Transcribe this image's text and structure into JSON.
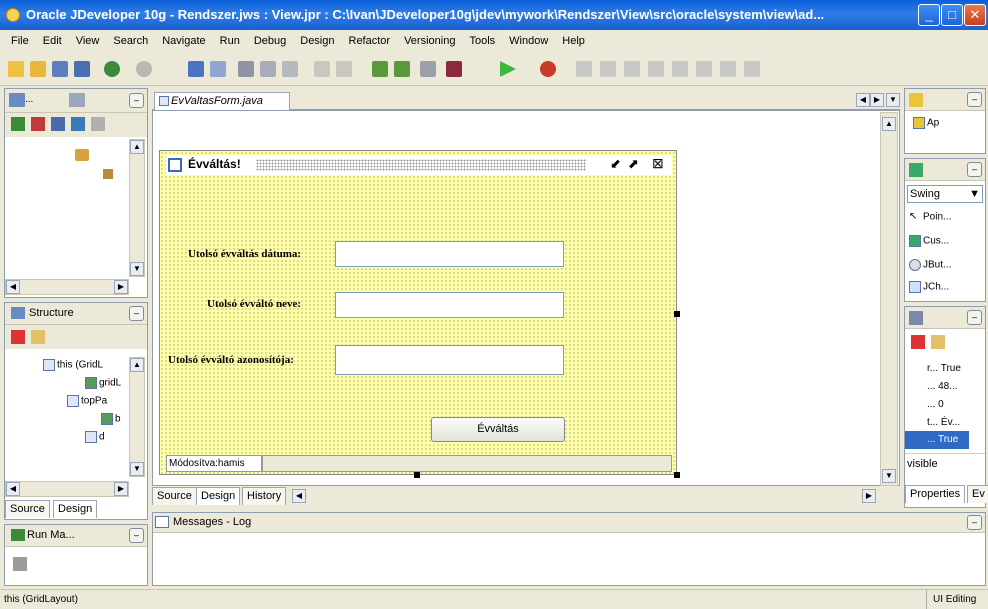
{
  "window": {
    "title": "Oracle JDeveloper 10g - Rendszer.jws : View.jpr : C:\\Ivan\\JDeveloper10g\\jdev\\mywork\\Rendszer\\View\\src\\oracle\\system\\view\\ad..."
  },
  "menu": [
    "File",
    "Edit",
    "View",
    "Search",
    "Navigate",
    "Run",
    "Debug",
    "Design",
    "Refactor",
    "Versioning",
    "Tools",
    "Window",
    "Help"
  ],
  "left": {
    "top_tab": "...",
    "structure_title": "Structure",
    "tree": [
      "this (GridL",
      "gridL",
      "topPa",
      "b",
      "d"
    ],
    "bottom_tabs": [
      "Source",
      "Design"
    ],
    "run_title": "Run Ma..."
  },
  "editor": {
    "file_tab": "EvValtasForm.java",
    "bottom_tabs": [
      "Source",
      "Design",
      "History"
    ],
    "form": {
      "title": "Évváltás!",
      "fields": [
        {
          "label": "Utolsó évváltás dátuma:",
          "value": ""
        },
        {
          "label": "Utolsó évváltó neve:",
          "value": ""
        },
        {
          "label": "Utolsó évváltó azonosítója:",
          "value": ""
        }
      ],
      "button": "Évváltás",
      "status": "Módosítva:hamis"
    }
  },
  "messages": {
    "title": "Messages - Log"
  },
  "right": {
    "top_item": "Ap",
    "palette_select": "Swing",
    "palette_items": [
      "Poin...",
      "Cus...",
      "JBut...",
      "JCh..."
    ],
    "props": [
      {
        "name": "r...",
        "value": "True"
      },
      {
        "name": "...",
        "value": "48..."
      },
      {
        "name": "...",
        "value": "0"
      },
      {
        "name": "t...",
        "value": "Év..."
      },
      {
        "name": "...",
        "value": "True"
      }
    ],
    "prop_desc": "visible",
    "tabs": [
      "Properties",
      "Ev"
    ]
  },
  "status": {
    "left": "this (GridLayout)",
    "right": "UI Editing"
  }
}
